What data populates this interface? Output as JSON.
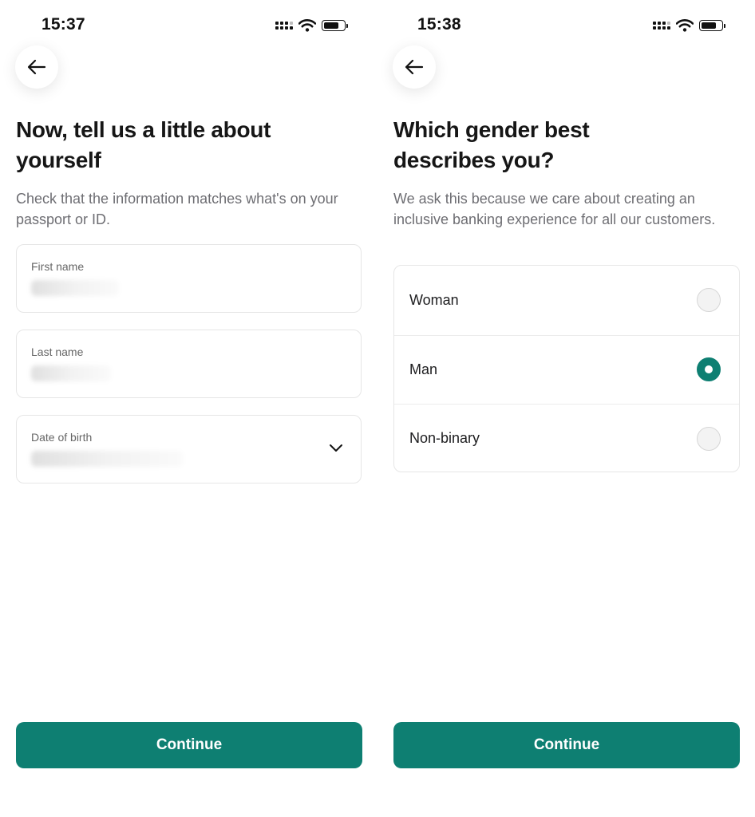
{
  "screen1": {
    "status": {
      "time": "15:37"
    },
    "title": "Now, tell us a little about yourself",
    "subtitle": "Check that the information matches what's on your passport or ID.",
    "fields": [
      {
        "label": "First name"
      },
      {
        "label": "Last name"
      },
      {
        "label": "Date of birth"
      }
    ],
    "continue_label": "Continue"
  },
  "screen2": {
    "status": {
      "time": "15:38"
    },
    "title": "Which gender best describes you?",
    "subtitle": "We ask this because we care about creating an inclusive banking experience for all our customers.",
    "options": [
      {
        "label": "Woman",
        "selected": false
      },
      {
        "label": "Man",
        "selected": true
      },
      {
        "label": "Non-binary",
        "selected": false
      }
    ],
    "continue_label": "Continue"
  },
  "colors": {
    "accent": "#0e7f72",
    "text": "#161616",
    "muted": "#6e6e73",
    "border": "#e6e6e6"
  },
  "icons": {
    "back": "arrow-left-icon",
    "dropdown": "chevron-down-icon",
    "signal": "cellular-signal-icon",
    "wifi": "wifi-icon",
    "battery": "battery-icon"
  }
}
